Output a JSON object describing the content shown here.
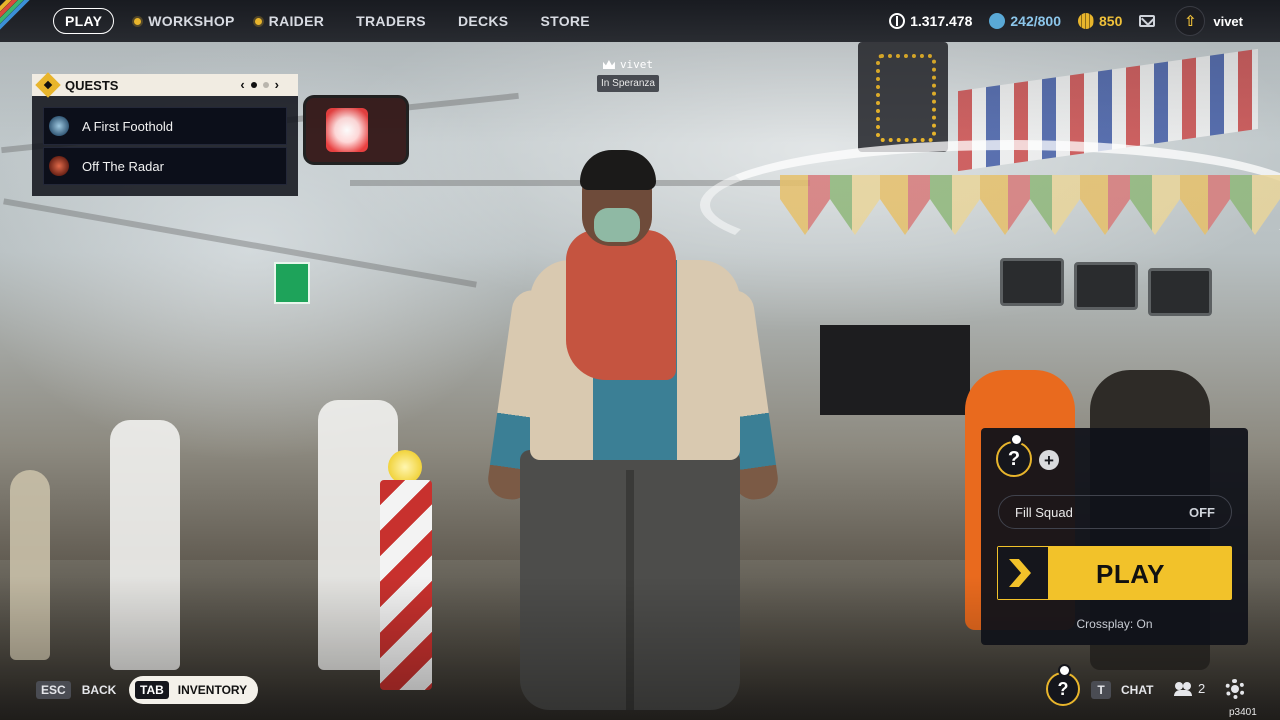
{
  "topbar": {
    "nav": [
      {
        "label": "PLAY",
        "active": true,
        "dot": false
      },
      {
        "label": "WORKSHOP",
        "active": false,
        "dot": true
      },
      {
        "label": "RAIDER",
        "active": false,
        "dot": true
      },
      {
        "label": "TRADERS",
        "active": false,
        "dot": false
      },
      {
        "label": "DECKS",
        "active": false,
        "dot": false
      },
      {
        "label": "STORE",
        "active": false,
        "dot": false
      }
    ],
    "currencies": {
      "coins": "1.317.478",
      "credits": "242/800",
      "gold": "850"
    },
    "profile_name": "vivet",
    "profile_icon": "level-up-arrow-icon"
  },
  "quests": {
    "title": "QUESTS",
    "prev": "‹",
    "next": "›",
    "items": [
      {
        "label": "A First Foothold",
        "icon": "globe-icon"
      },
      {
        "label": "Off The Radar",
        "icon": "target-icon"
      }
    ]
  },
  "player_tag": {
    "name": "vivet",
    "location": "In Speranza"
  },
  "squad": {
    "slot_symbol": "?",
    "add_symbol": "+",
    "fill_squad_label": "Fill Squad",
    "fill_squad_value": "OFF",
    "play_label": "PLAY",
    "crossplay": "Crossplay: On"
  },
  "bottom": {
    "back_key": "ESC",
    "back_label": "BACK",
    "inventory_key": "TAB",
    "inventory_label": "INVENTORY",
    "slot_symbol": "?",
    "chat_key": "T",
    "chat_label": "CHAT",
    "friends_count": "2",
    "build": "p3401"
  },
  "colors": {
    "accent": "#f2c22a",
    "panel": "#10121a",
    "stripes": [
      "#e8b52c",
      "#d94a3c",
      "#3cb46e",
      "#3b8fd6"
    ]
  }
}
